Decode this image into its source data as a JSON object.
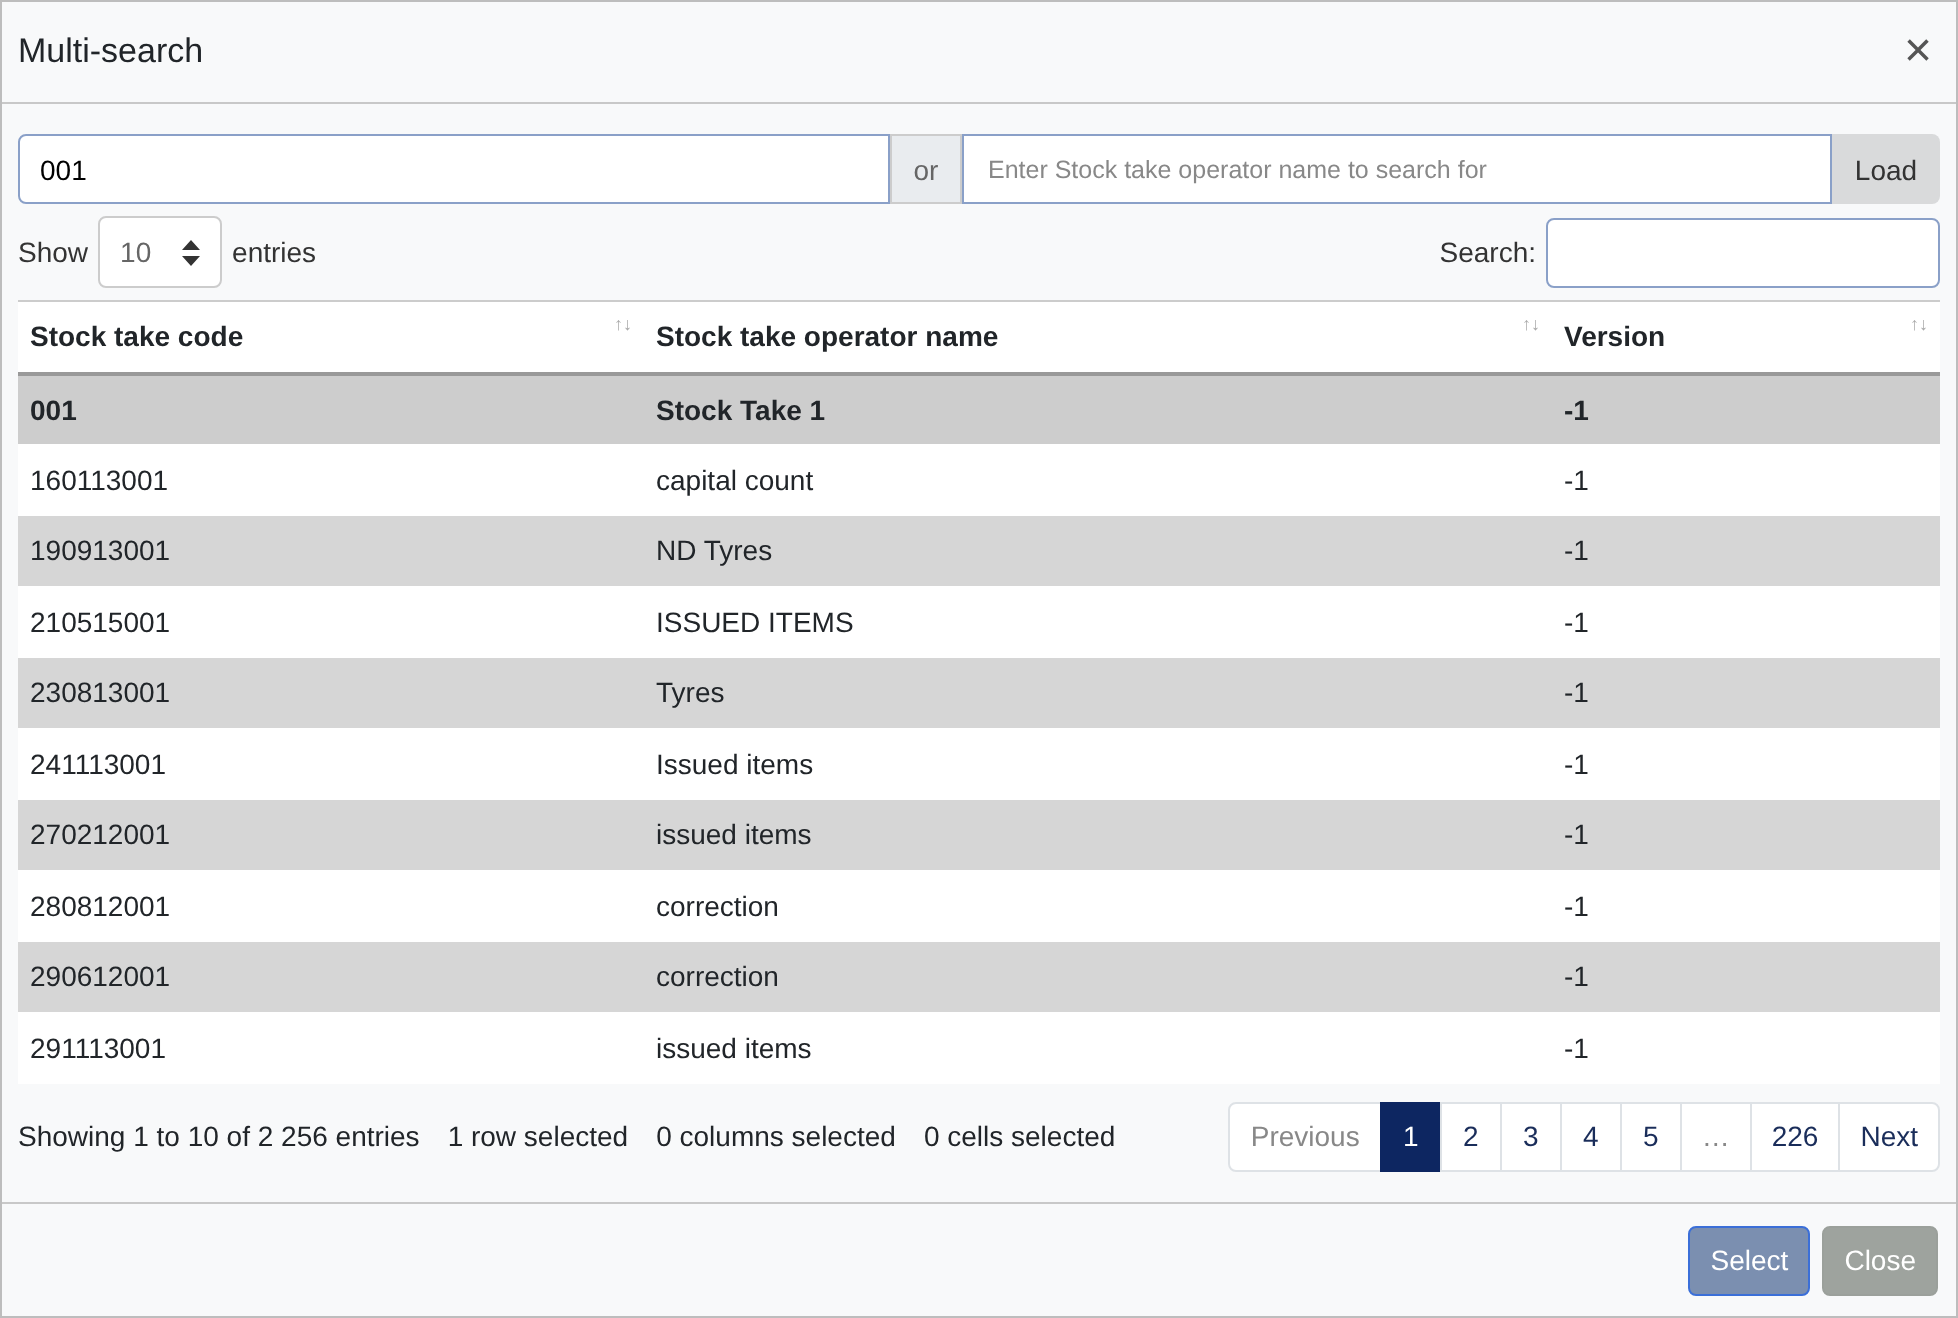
{
  "window": {
    "title": "Multi-search",
    "close": "×"
  },
  "search_bar": {
    "code_value": "001",
    "or_label": "or",
    "name_placeholder": "Enter Stock take operator name to search for",
    "load_button": "Load"
  },
  "length": {
    "show_label": "Show",
    "value": "10",
    "entries_label": "entries"
  },
  "filter": {
    "label": "Search:"
  },
  "table": {
    "columns": [
      {
        "label": "Stock take code",
        "sort": "↑↓"
      },
      {
        "label": "Stock take operator name",
        "sort": "↑↓"
      },
      {
        "label": "Version",
        "sort": "↑↓"
      }
    ],
    "rows": [
      {
        "cells": [
          "001",
          "Stock Take 1",
          "-1"
        ],
        "selected": true
      },
      {
        "cells": [
          "160113001",
          "capital count",
          "-1"
        ],
        "selected": false
      },
      {
        "cells": [
          "190913001",
          "ND Tyres",
          "-1"
        ],
        "selected": false
      },
      {
        "cells": [
          "210515001",
          "ISSUED ITEMS",
          "-1"
        ],
        "selected": false
      },
      {
        "cells": [
          "230813001",
          "Tyres",
          "-1"
        ],
        "selected": false
      },
      {
        "cells": [
          "241113001",
          "Issued items",
          "-1"
        ],
        "selected": false
      },
      {
        "cells": [
          "270212001",
          "issued items",
          "-1"
        ],
        "selected": false
      },
      {
        "cells": [
          "280812001",
          "correction",
          "-1"
        ],
        "selected": false
      },
      {
        "cells": [
          "290612001",
          "correction",
          "-1"
        ],
        "selected": false
      },
      {
        "cells": [
          "291113001",
          "issued items",
          "-1"
        ],
        "selected": false
      }
    ]
  },
  "info": {
    "showing": "Showing 1 to 10 of 2 256 entries",
    "rows_selected": "1 row selected",
    "columns_selected": "0 columns selected",
    "cells_selected": "0 cells selected"
  },
  "pagination": [
    {
      "label": "Previous",
      "kind": "link",
      "selected": false,
      "disabled": true
    },
    {
      "label": "1",
      "kind": "link",
      "selected": true,
      "disabled": false
    },
    {
      "label": "2",
      "kind": "link",
      "selected": false,
      "disabled": false
    },
    {
      "label": "3",
      "kind": "link",
      "selected": false,
      "disabled": false
    },
    {
      "label": "4",
      "kind": "link",
      "selected": false,
      "disabled": false
    },
    {
      "label": "5",
      "kind": "link",
      "selected": false,
      "disabled": false
    },
    {
      "label": "…",
      "kind": "ellipsis"
    },
    {
      "label": "226",
      "kind": "link",
      "selected": false,
      "disabled": false
    },
    {
      "label": "Next",
      "kind": "link",
      "selected": false,
      "disabled": false
    }
  ],
  "footer_buttons": [
    {
      "label": "Select",
      "kind": "primary"
    },
    {
      "label": "Close",
      "kind": "secondary"
    }
  ]
}
